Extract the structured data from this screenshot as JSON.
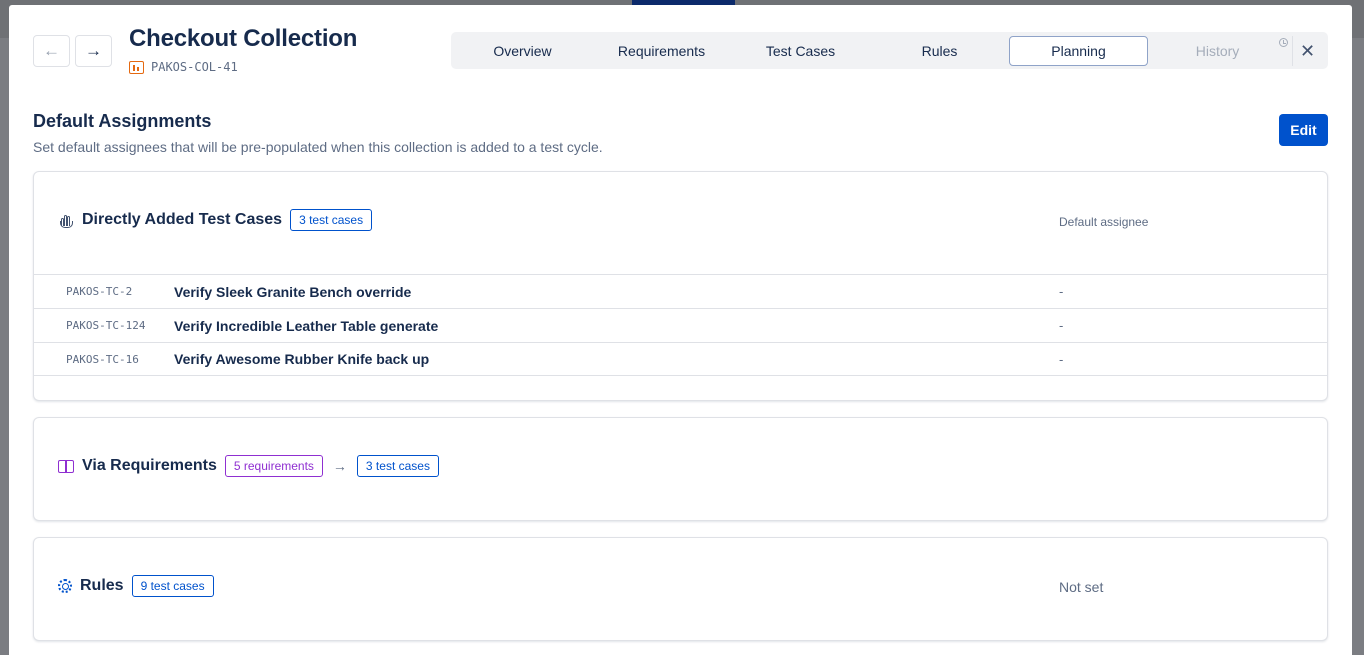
{
  "header": {
    "title": "Checkout Collection",
    "collection_key": "PAKOS-COL-41",
    "back_icon": "←",
    "forward_icon": "→",
    "close_icon": "✕"
  },
  "tabs": [
    {
      "label": "Overview",
      "state": "normal"
    },
    {
      "label": "Requirements",
      "state": "normal"
    },
    {
      "label": "Test Cases",
      "state": "normal"
    },
    {
      "label": "Rules",
      "state": "normal"
    },
    {
      "label": "Planning",
      "state": "active"
    },
    {
      "label": "History",
      "state": "disabled"
    }
  ],
  "section": {
    "title": "Default Assignments",
    "description": "Set default assignees that will be pre-populated when this collection is added to a test cycle.",
    "edit_label": "Edit"
  },
  "direct": {
    "title": "Directly Added Test Cases",
    "badge": "3 test cases",
    "column_label": "Default assignee",
    "rows": [
      {
        "key": "PAKOS-TC-2",
        "name": "Verify Sleek Granite Bench override",
        "assignee": "-"
      },
      {
        "key": "PAKOS-TC-124",
        "name": "Verify Incredible Leather Table generate",
        "assignee": "-"
      },
      {
        "key": "PAKOS-TC-16",
        "name": "Verify Awesome Rubber Knife back up",
        "assignee": "-"
      }
    ]
  },
  "via_requirements": {
    "title": "Via Requirements",
    "req_badge": "5 requirements",
    "arrow": "→",
    "tc_badge": "3 test cases"
  },
  "rules": {
    "title": "Rules",
    "badge": "9 test cases",
    "assignee": "Not set"
  },
  "colors": {
    "primary": "#0052cc",
    "requirement_purple": "#8f2fd1",
    "key_icon_orange": "#e56910"
  }
}
